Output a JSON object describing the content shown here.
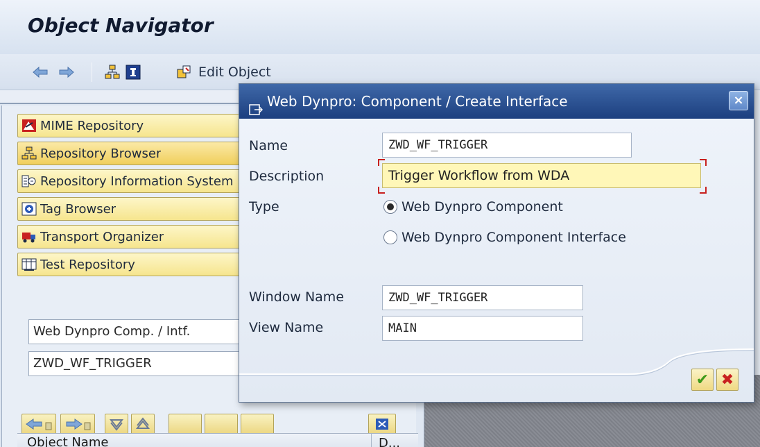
{
  "titlebar": {
    "title": "Object Navigator"
  },
  "toolbar": {
    "icons": [
      "back-arrow-icon",
      "forward-arrow-icon",
      "hierarchy-icon",
      "info-icon",
      "edit-object-icon"
    ],
    "edit_object_label": "Edit Object"
  },
  "navigator": {
    "items": [
      {
        "label": "MIME Repository",
        "icon": "mime-icon"
      },
      {
        "label": "Repository Browser",
        "icon": "tree-icon",
        "active": true
      },
      {
        "label": "Repository Information System",
        "icon": "info-system-icon"
      },
      {
        "label": "Tag Browser",
        "icon": "tag-icon"
      },
      {
        "label": "Transport Organizer",
        "icon": "truck-icon"
      },
      {
        "label": "Test Repository",
        "icon": "test-icon"
      }
    ],
    "object_type_field": "Web Dynpro Comp. / Intf.",
    "object_name_field": "ZWD_WF_TRIGGER",
    "table_headers": {
      "object_name": "Object Name",
      "description": "D..."
    }
  },
  "dialog": {
    "title": "Web Dynpro: Component / Create Interface",
    "close_label": "×",
    "fields": {
      "name_label": "Name",
      "name_value": "ZWD_WF_TRIGGER",
      "description_label": "Description",
      "description_value": "Trigger Workflow from WDA",
      "type_label": "Type",
      "type_option_component": "Web Dynpro Component",
      "type_option_interface": "Web Dynpro Component Interface",
      "type_selected": "Web Dynpro Component",
      "window_name_label": "Window Name",
      "window_name_value": "ZWD_WF_TRIGGER",
      "view_name_label": "View Name",
      "view_name_value": "MAIN"
    },
    "ok_label": "✔",
    "cancel_label": "✖"
  }
}
